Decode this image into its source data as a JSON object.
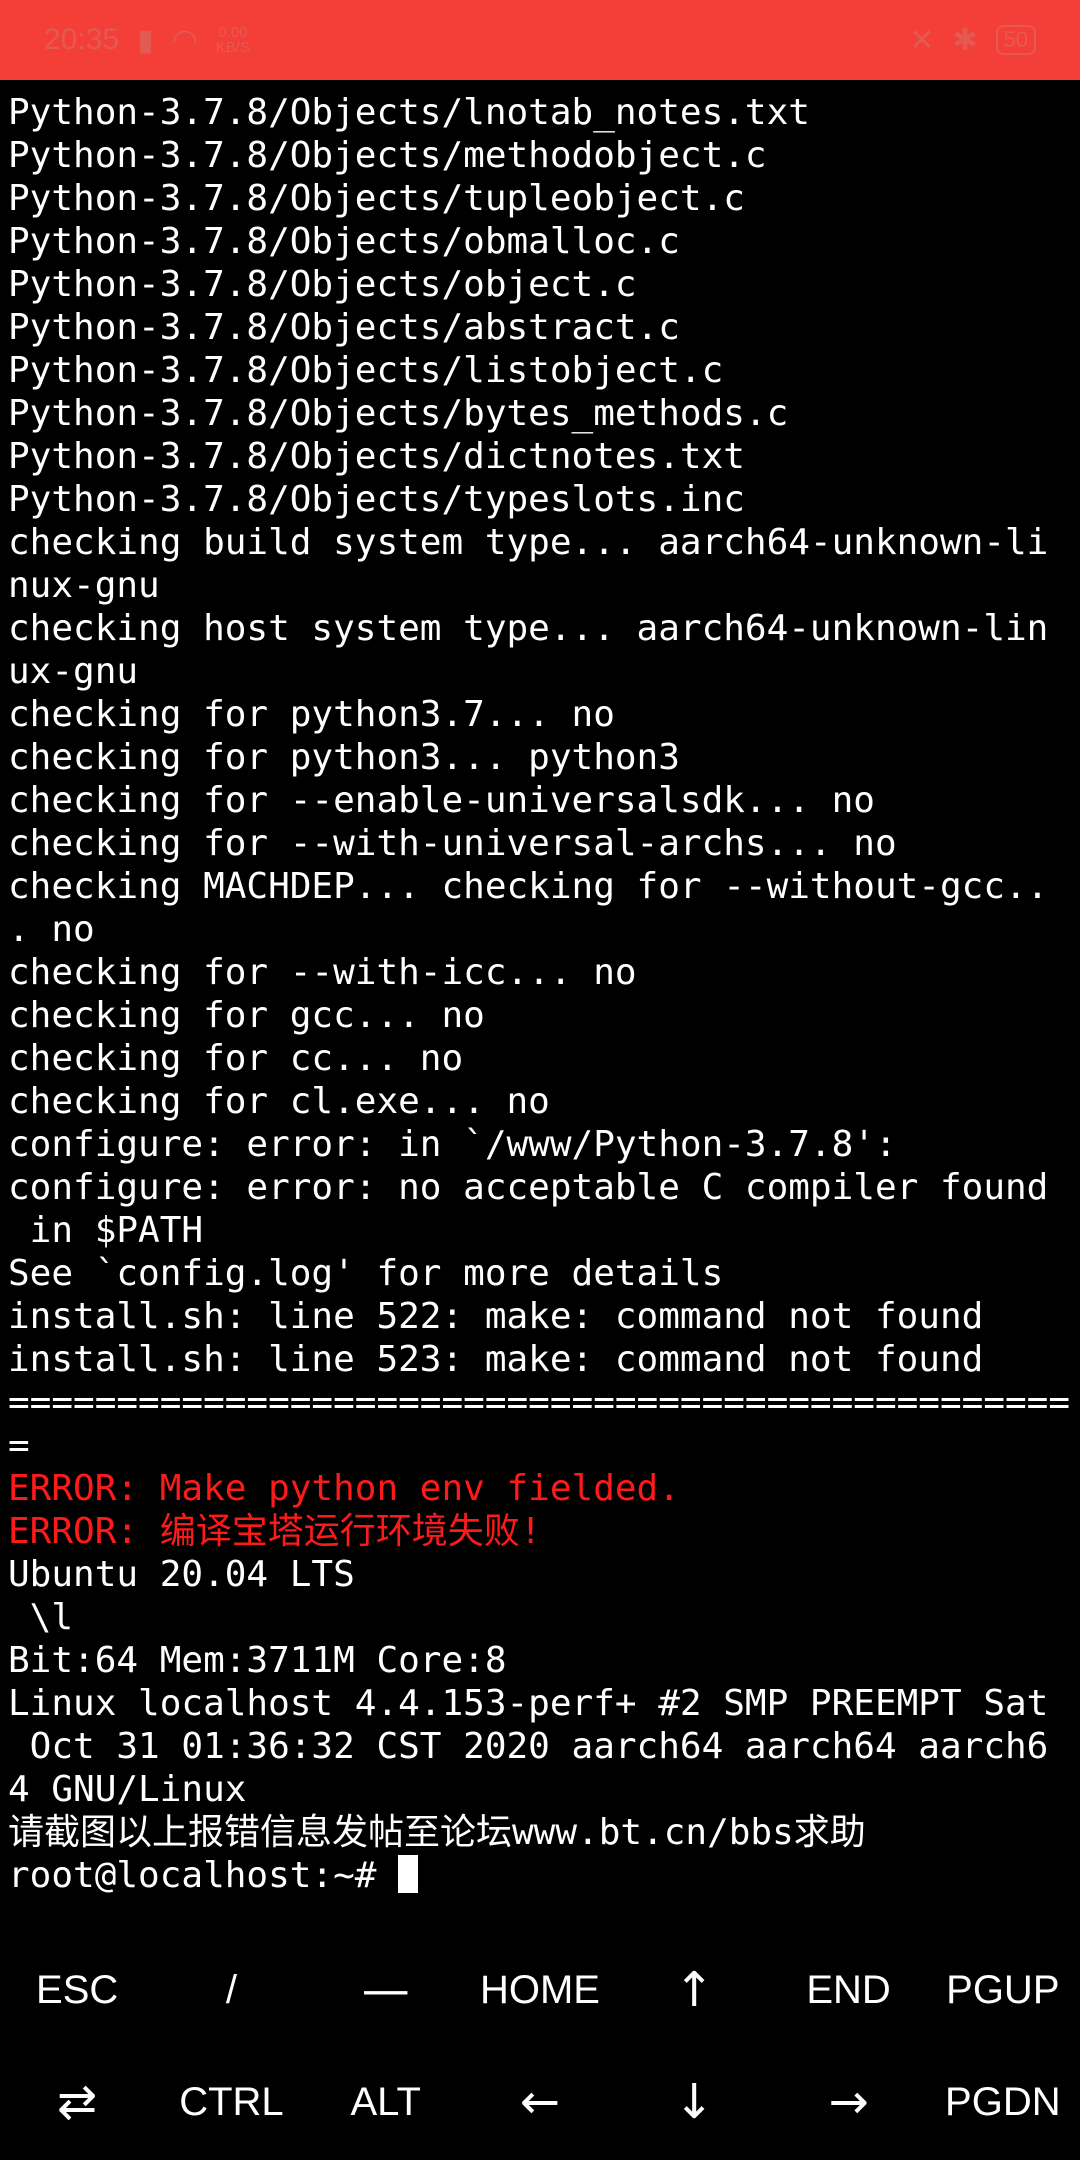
{
  "status_bar": {
    "time": "20:35",
    "net_speed_top": "0.00",
    "net_speed_bottom": "KB/S",
    "battery": "50",
    "accent_color": "#f43e38"
  },
  "terminal": {
    "lines": [
      "Python-3.7.8/Objects/lnotab_notes.txt",
      "Python-3.7.8/Objects/methodobject.c",
      "Python-3.7.8/Objects/tupleobject.c",
      "Python-3.7.8/Objects/obmalloc.c",
      "Python-3.7.8/Objects/object.c",
      "Python-3.7.8/Objects/abstract.c",
      "Python-3.7.8/Objects/listobject.c",
      "Python-3.7.8/Objects/bytes_methods.c",
      "Python-3.7.8/Objects/dictnotes.txt",
      "Python-3.7.8/Objects/typeslots.inc",
      "checking build system type... aarch64-unknown-li",
      "nux-gnu",
      "checking host system type... aarch64-unknown-lin",
      "ux-gnu",
      "checking for python3.7... no",
      "checking for python3... python3",
      "checking for --enable-universalsdk... no",
      "checking for --with-universal-archs... no",
      "checking MACHDEP... checking for --without-gcc..",
      ". no",
      "checking for --with-icc... no",
      "checking for gcc... no",
      "checking for cc... no",
      "checking for cl.exe... no",
      "configure: error: in `/www/Python-3.7.8':",
      "configure: error: no acceptable C compiler found",
      " in $PATH",
      "See `config.log' for more details",
      "install.sh: line 522: make: command not found",
      "install.sh: line 523: make: command not found",
      "=================================================",
      "=",
      "ERROR: Make python env fielded.",
      "ERROR: 编译宝塔运行环境失败!",
      "Ubuntu 20.04 LTS",
      " \\l",
      "Bit:64 Mem:3711M Core:8",
      "Linux localhost 4.4.153-perf+ #2 SMP PREEMPT Sat",
      " Oct 31 01:36:32 CST 2020 aarch64 aarch64 aarch6",
      "4 GNU/Linux",
      "请截图以上报错信息发帖至论坛www.bt.cn/bbs求助"
    ],
    "prompt": "root@localhost:~# ",
    "error_color": "#ff1a1a"
  },
  "extra_keys": {
    "row1": [
      {
        "name": "esc",
        "label": "ESC"
      },
      {
        "name": "slash",
        "label": "/"
      },
      {
        "name": "dash",
        "label": "—"
      },
      {
        "name": "home",
        "label": "HOME"
      },
      {
        "name": "arrow-up",
        "label": "↑"
      },
      {
        "name": "end",
        "label": "END"
      },
      {
        "name": "pgup",
        "label": "PGUP"
      }
    ],
    "row2": [
      {
        "name": "tab",
        "label": "⇄"
      },
      {
        "name": "ctrl",
        "label": "CTRL"
      },
      {
        "name": "alt",
        "label": "ALT"
      },
      {
        "name": "arrow-left",
        "label": "←"
      },
      {
        "name": "arrow-down",
        "label": "↓"
      },
      {
        "name": "arrow-right",
        "label": "→"
      },
      {
        "name": "pgdn",
        "label": "PGDN"
      }
    ]
  }
}
